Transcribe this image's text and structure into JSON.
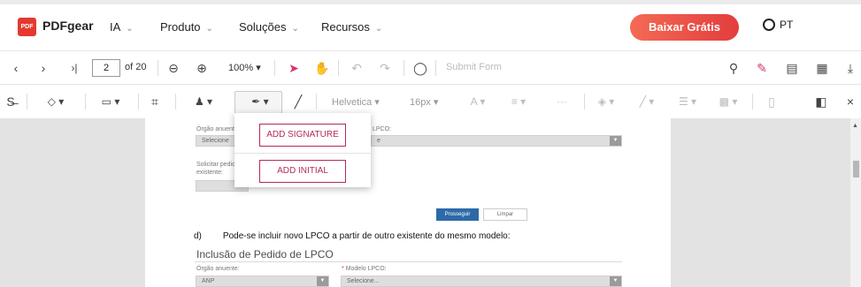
{
  "nav": {
    "logo_mark": "PDF",
    "brand": "PDFgear",
    "items": [
      "IA",
      "Produto",
      "Soluções",
      "Recursos"
    ],
    "cta": "Baixar Grátis",
    "lang": "PT"
  },
  "toolbar": {
    "page_current": "2",
    "page_total": "of 20",
    "zoom": "100%",
    "submit_placeholder": "Submit Form"
  },
  "annotation_toolbar": {
    "font": "Helvetica",
    "font_size": "16px"
  },
  "signature_menu": {
    "add_signature": "ADD SIGNATURE",
    "add_initial": "ADD INITIAL"
  },
  "document": {
    "top_form": {
      "orgao_label": "Órgão anuente:",
      "orgao_value": "Selecione",
      "modelo_label": "LPCO:",
      "modelo_value": "e",
      "solicitar_label_1": "Solicitar pedido",
      "solicitar_label_2": "existente:"
    },
    "btn_prosseguir": "Prosseguir",
    "btn_limpar": "Limpar",
    "item_num": "d)",
    "item_text": "Pode-se incluir novo LPCO a partir de outro existente do mesmo modelo:",
    "section_title": "Inclusão de Pedido de LPCO",
    "bottom_form": {
      "orgao_label": "Órgão anuente:",
      "orgao_value": "ANP",
      "modelo_required": "*",
      "modelo_label": "Modelo LPCO:",
      "modelo_value": "Selecione..."
    }
  },
  "colors": {
    "cta_start": "#f46a55",
    "cta_end": "#e33d3d",
    "accent_magenta": "#b52a5a",
    "form_blue": "#2d6aa8",
    "viewer_bg": "#e3e3e3"
  },
  "icons": [
    "pdf-logo-icon",
    "chevron-down-icon",
    "globe-icon",
    "chevron-left-icon",
    "chevron-right-icon",
    "last-page-icon",
    "zoom-out-icon",
    "zoom-in-icon",
    "select-cursor-icon",
    "hand-icon",
    "undo-icon",
    "redo-icon",
    "comment-icon",
    "search-icon",
    "edit-icon",
    "save-icon",
    "print-icon",
    "download-icon",
    "strikethrough-icon",
    "shape-icon",
    "image-icon",
    "crop-icon",
    "stamp-icon",
    "signature-pen-icon",
    "brush-icon",
    "text-color-icon",
    "align-icon",
    "more-icon",
    "fill-icon",
    "line-icon",
    "stroke-icon",
    "opacity-icon",
    "delete-icon",
    "panel-icon",
    "close-icon"
  ]
}
